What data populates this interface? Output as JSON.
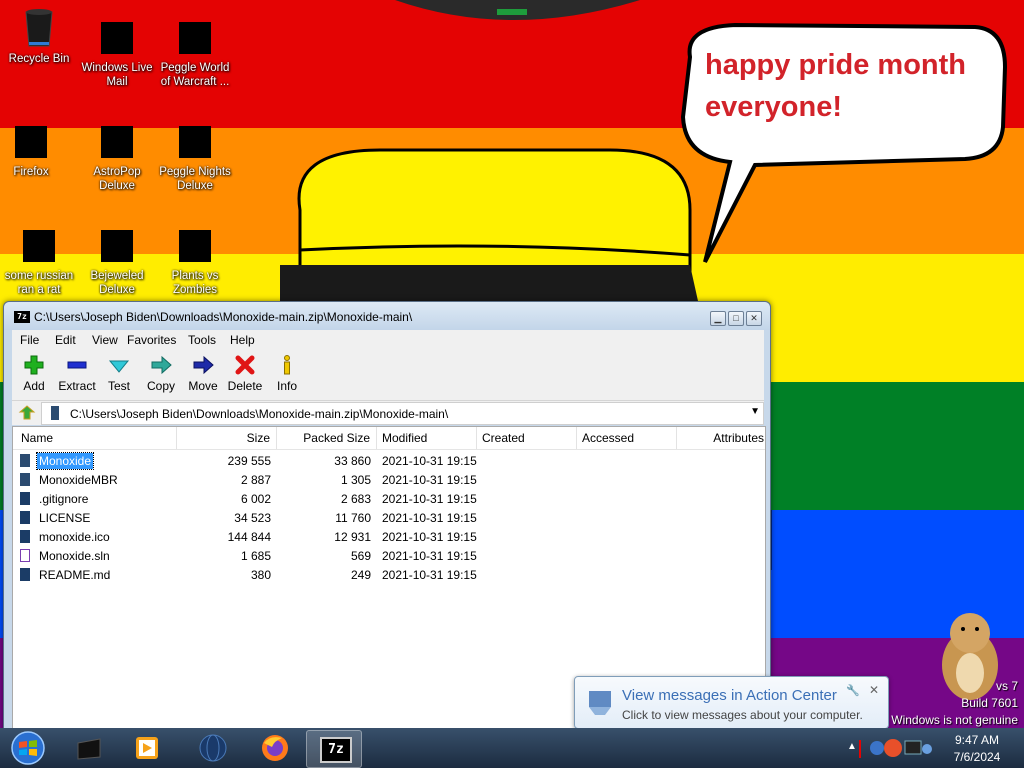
{
  "colors": {
    "red": "#e40303",
    "orange": "#ff8c00",
    "yellow": "#ffed00",
    "green": "#008026",
    "blue": "#004dff",
    "purple": "#750787",
    "window_chrome": "#c7d8ea",
    "selection": "#3399ff",
    "speech_text": "#d2232a",
    "taskbar": "#1c2c40"
  },
  "wallpaper": {
    "speech_line1": "happy pride month",
    "speech_line2": "everyone!",
    "watermark_partial1": "vs 7",
    "watermark_build": "Build 7601",
    "watermark_genuine": "Windows is not genuine"
  },
  "desktop_icons": [
    {
      "label": "Recycle Bin",
      "icon": "recycle-bin-icon"
    },
    {
      "label": "Windows Live Mail",
      "icon": "redacted-icon"
    },
    {
      "label": "Peggle World of Warcraft ...",
      "icon": "redacted-icon"
    },
    {
      "label": "Firefox",
      "icon": "redacted-icon"
    },
    {
      "label": "AstroPop Deluxe",
      "icon": "redacted-icon"
    },
    {
      "label": "Peggle Nights Deluxe",
      "icon": "redacted-icon"
    },
    {
      "label": "some russian ran a rat",
      "icon": "redacted-icon"
    },
    {
      "label": "Bejeweled Deluxe",
      "icon": "redacted-icon"
    },
    {
      "label": "Plants vs Zombies",
      "icon": "redacted-icon"
    }
  ],
  "window": {
    "title": "C:\\Users\\Joseph Biden\\Downloads\\Monoxide-main.zip\\Monoxide-main\\",
    "app_tag": "7z",
    "menu": [
      "File",
      "Edit",
      "View",
      "Favorites",
      "Tools",
      "Help"
    ],
    "toolbar": [
      {
        "label": "Add",
        "icon": "add-icon"
      },
      {
        "label": "Extract",
        "icon": "extract-icon"
      },
      {
        "label": "Test",
        "icon": "test-icon"
      },
      {
        "label": "Copy",
        "icon": "copy-icon"
      },
      {
        "label": "Move",
        "icon": "move-icon"
      },
      {
        "label": "Delete",
        "icon": "delete-icon"
      },
      {
        "label": "Info",
        "icon": "info-icon"
      }
    ],
    "address": "C:\\Users\\Joseph Biden\\Downloads\\Monoxide-main.zip\\Monoxide-main\\",
    "columns": [
      "Name",
      "Size",
      "Packed Size",
      "Modified",
      "Created",
      "Accessed",
      "Attributes"
    ],
    "files": [
      {
        "name": "Monoxide",
        "size": "239 555",
        "packed": "33 860",
        "modified": "2021-10-31 19:15",
        "icon": "folder-icon",
        "selected": true
      },
      {
        "name": "MonoxideMBR",
        "size": "2 887",
        "packed": "1 305",
        "modified": "2021-10-31 19:15",
        "icon": "folder-icon",
        "selected": false
      },
      {
        "name": ".gitignore",
        "size": "6 002",
        "packed": "2 683",
        "modified": "2021-10-31 19:15",
        "icon": "file-icon",
        "selected": false
      },
      {
        "name": "LICENSE",
        "size": "34 523",
        "packed": "11 760",
        "modified": "2021-10-31 19:15",
        "icon": "file-icon",
        "selected": false
      },
      {
        "name": "monoxide.ico",
        "size": "144 844",
        "packed": "12 931",
        "modified": "2021-10-31 19:15",
        "icon": "file-icon",
        "selected": false
      },
      {
        "name": "Monoxide.sln",
        "size": "1 685",
        "packed": "569",
        "modified": "2021-10-31 19:15",
        "icon": "vs-solution-icon",
        "selected": false
      },
      {
        "name": "README.md",
        "size": "380",
        "packed": "249",
        "modified": "2021-10-31 19:15",
        "icon": "file-icon",
        "selected": false
      }
    ]
  },
  "notification": {
    "title": "View messages in Action Center",
    "body": "Click to view messages about your computer."
  },
  "taskbar": {
    "apps": [
      "start-orb-icon",
      "black-app-icon",
      "media-player-icon",
      "globe-icon",
      "firefox-icon",
      "7zip-icon"
    ],
    "time": "9:47 AM",
    "date": "7/6/2024"
  }
}
